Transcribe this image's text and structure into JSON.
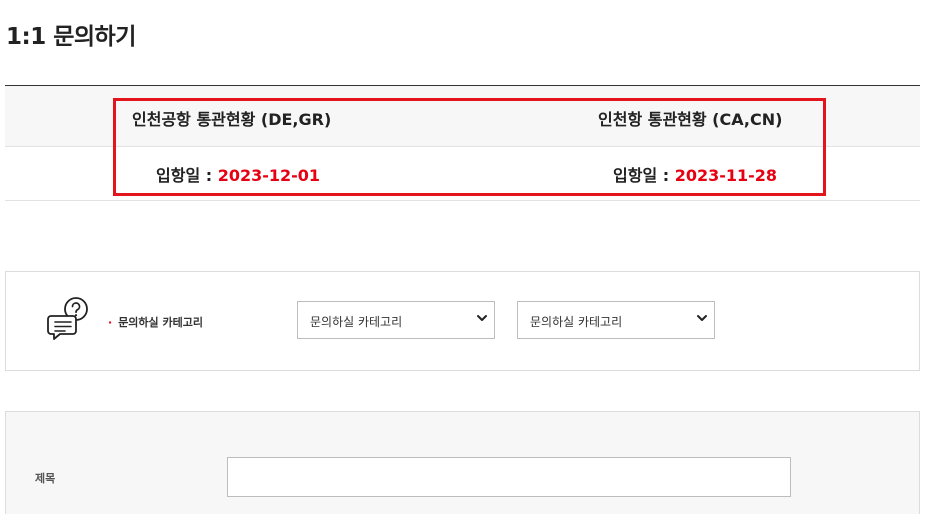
{
  "page": {
    "title": "1:1 문의하기"
  },
  "customs": {
    "incheon_airport": {
      "label": "인천공항 통관현황 (DE,GR)",
      "date_label": "입항일 : ",
      "date_value": "2023-12-01"
    },
    "incheon_port": {
      "label": "인천항 통관현황 (CA,CN)",
      "date_label": "입항일 : ",
      "date_value": "2023-11-28"
    },
    "highlight_color": "#e3141c",
    "date_color": "#e60012"
  },
  "category": {
    "icon": "chat-question-icon",
    "label": "문의하실 카테고리",
    "select_primary": {
      "selected": "문의하실 카테고리"
    },
    "select_secondary": {
      "selected": "문의하실 카테고리"
    }
  },
  "subject": {
    "label": "제목",
    "value": "",
    "placeholder": ""
  }
}
